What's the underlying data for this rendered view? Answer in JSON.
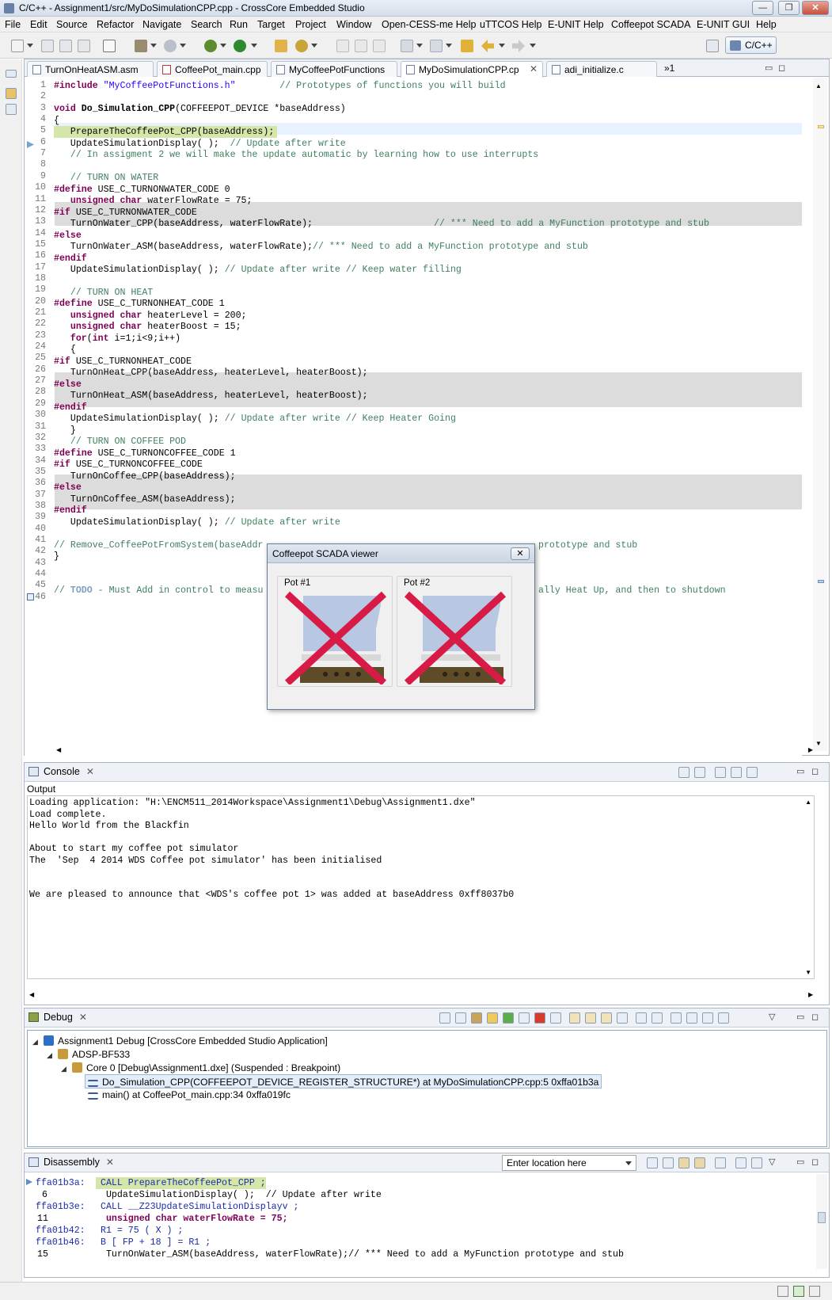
{
  "window": {
    "title": "C/C++ - Assignment1/src/MyDoSimulationCPP.cpp - CrossCore Embedded Studio",
    "minimize": "—",
    "maximize": "❐",
    "close": "✕"
  },
  "menu": [
    "File",
    "Edit",
    "Source",
    "Refactor",
    "Navigate",
    "Search",
    "Run",
    "Target",
    "Project",
    "Window",
    "Open-CESS-me Help",
    "uTTCOS Help",
    "E-UNIT Help",
    "Coffeepot SCADA",
    "E-UNIT GUI",
    "Help"
  ],
  "perspective": "C/C++",
  "editor": {
    "tabs": [
      "TurnOnHeatASM.asm",
      "CoffeePot_main.cpp",
      "MyCoffeePotFunctions",
      "MyDoSimulationCPP.cp",
      "adi_initialize.c"
    ],
    "active_tab": 3,
    "overflow_count": "»1",
    "line_numbers": [
      "1",
      "2",
      "3",
      "4",
      "5",
      "6",
      "7",
      "8",
      "9",
      "10",
      "11",
      "12",
      "13",
      "14",
      "15",
      "16",
      "17",
      "18",
      "19",
      "20",
      "21",
      "22",
      "23",
      "24",
      "25",
      "26",
      "27",
      "28",
      "29",
      "30",
      "31",
      "32",
      "33",
      "34",
      "35",
      "36",
      "37",
      "38",
      "39",
      "40",
      "41",
      "42",
      "43",
      "44",
      "45",
      "46"
    ]
  },
  "code": {
    "l1a": "#include ",
    "l1b": "\"MyCoffeePotFunctions.h\"",
    "l1c": "        // Prototypes of functions you will build",
    "l3a": "void ",
    "l3b": "Do_Simulation_CPP",
    "l3c": "(COFFEEPOT_DEVICE *baseAddress)",
    "l4": "{",
    "l5": "   PrepareTheCoffeePot_CPP(baseAddress);",
    "l6a": "   UpdateSimulationDisplay( );",
    "l6b": "  // Update after write",
    "l7": "   // In assigment 2 we will make the update automatic by learning how to use interrupts",
    "l9": "   // TURN ON WATER",
    "l10a": "#define",
    "l10b": " USE_C_TURNONWATER_CODE 0",
    "l11a": "   unsigned char",
    "l11b": " waterFlowRate = 75;",
    "l12a": "#if",
    "l12b": " USE_C_TURNONWATER_CODE",
    "l13a": "   TurnOnWater_CPP(baseAddress, waterFlowRate);",
    "l13b": "                      // *** Need to add a MyFunction prototype and stub",
    "l14": "#else",
    "l15a": "   TurnOnWater_ASM(baseAddress, waterFlowRate);",
    "l15b": "// *** Need to add a MyFunction prototype and stub",
    "l16": "#endif",
    "l17a": "   UpdateSimulationDisplay( );",
    "l17b": " // Update after write // Keep water filling",
    "l19": "   // TURN ON HEAT",
    "l20a": "#define",
    "l20b": " USE_C_TURNONHEAT_CODE 1",
    "l21a": "   unsigned char",
    "l21b": " heaterLevel = 200;",
    "l22a": "   unsigned char",
    "l22b": " heaterBoost = 15;",
    "l23a": "   for",
    "l23b": "(",
    "l23c": "int",
    "l23d": " i=1;i<9;i++)",
    "l24": "   {",
    "l25a": "#if",
    "l25b": " USE_C_TURNONHEAT_CODE",
    "l26": "   TurnOnHeat_CPP(baseAddress, heaterLevel, heaterBoost);",
    "l27": "#else",
    "l28": "   TurnOnHeat_ASM(baseAddress, heaterLevel, heaterBoost);",
    "l29": "#endif",
    "l30a": "   UpdateSimulationDisplay( );",
    "l30b": " // Update after write // Keep Heater Going",
    "l31": "   }",
    "l32": "   // TURN ON COFFEE POD",
    "l33a": "#define",
    "l33b": " USE_C_TURNONCOFFEE_CODE 1",
    "l34a": "#if",
    "l34b": " USE_C_TURNONCOFFEE_CODE",
    "l35": "   TurnOnCoffee_CPP(baseAddress);",
    "l36": "#else",
    "l37": "   TurnOnCoffee_ASM(baseAddress);",
    "l38": "#endif",
    "l39a": "   UpdateSimulationDisplay( );",
    "l39b": " // Update after write",
    "l41a": "// Remove_CoffeePotFromSystem(baseAddr",
    "l41b": "prototype and stub",
    "l42": "}",
    "l45a": "// ",
    "l45b": "TODO",
    "l45c": " - Must Add in control to measu",
    "l45d": "ally Heat Up, and then to shutdown"
  },
  "scada": {
    "title": "Coffeepot SCADA viewer",
    "close": "✕",
    "pots": [
      "Pot #1",
      "Pot #2"
    ]
  },
  "console": {
    "tab": "Console",
    "label": "Output",
    "lines": [
      "Loading application: \"H:\\ENCM511_2014Workspace\\Assignment1\\Debug\\Assignment1.dxe\"",
      "Load complete.",
      "Hello World from the Blackfin",
      "",
      "About to start my coffee pot simulator",
      "The  'Sep  4 2014 WDS Coffee pot simulator' has been initialised",
      "",
      "",
      "We are pleased to announce that <WDS's coffee pot 1> was added at baseAddress 0xff8037b0"
    ]
  },
  "debug": {
    "tab": "Debug",
    "nodes": [
      "Assignment1 Debug [CrossCore Embedded Studio Application]",
      "ADSP-BF533",
      "Core 0 [Debug\\Assignment1.dxe] (Suspended : Breakpoint)",
      "Do_Simulation_CPP(COFFEEPOT_DEVICE_REGISTER_STRUCTURE*) at MyDoSimulationCPP.cpp:5 0xffa01b3a",
      "main() at CoffeePot_main.cpp:34 0xffa019fc"
    ]
  },
  "disassembly": {
    "tab": "Disassembly",
    "location_placeholder": "Enter location here",
    "rows": [
      {
        "addr": "ffa01b3a:",
        "text": "CALL PrepareTheCoffeePot_CPP ;"
      },
      {
        "line": "6",
        "text": " UpdateSimulationDisplay( );  // Update after write"
      },
      {
        "addr": "ffa01b3e:",
        "text": "CALL __Z23UpdateSimulationDisplayv ;"
      },
      {
        "line": "11",
        "text": " unsigned char waterFlowRate = 75;"
      },
      {
        "addr": "ffa01b42:",
        "text": "R1 = 75 ( X ) ;"
      },
      {
        "addr": "ffa01b46:",
        "text": "B [ FP + 18 ] = R1 ;"
      },
      {
        "line": "15",
        "text": " TurnOnWater_ASM(baseAddress, waterFlowRate);// *** Need to add a MyFunction prototype and stub"
      }
    ]
  },
  "colors": {
    "keyword": "#7f0055",
    "comment": "#3f7f5f",
    "string": "#2a00ff",
    "shade": "#dcdcdc",
    "scada_cross": "#d81b46"
  }
}
